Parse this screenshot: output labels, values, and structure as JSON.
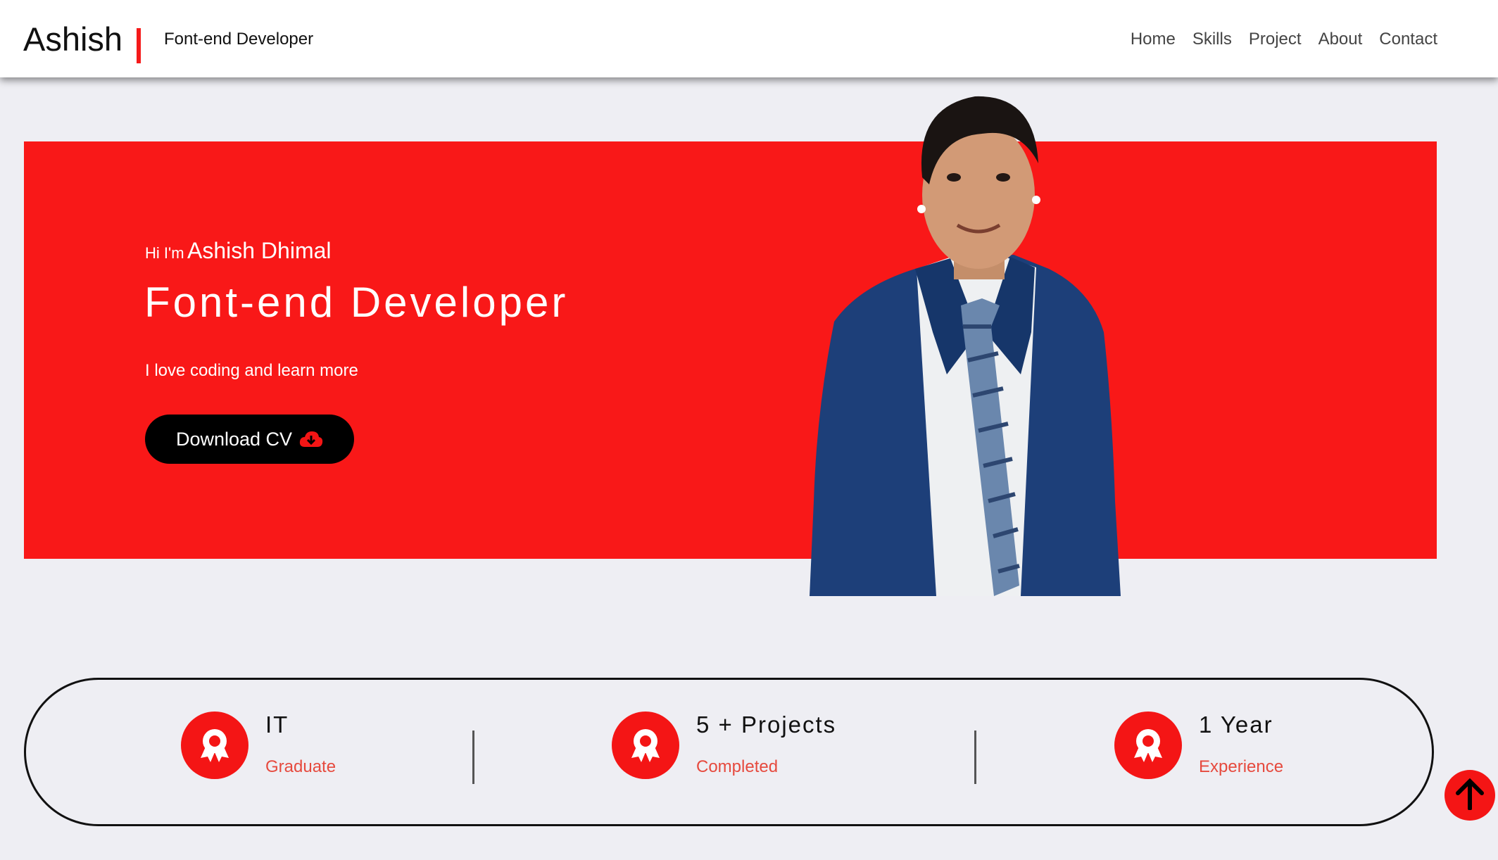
{
  "nav": {
    "brand": "Ashish",
    "subtitle": "Font-end Developer",
    "links": [
      "Home",
      "Skills",
      "Project",
      "About",
      "Contact"
    ]
  },
  "hero": {
    "greeting": "Hi I'm",
    "name": "Ashish Dhimal",
    "title": "Font-end Developer",
    "tagline": "I love coding and learn more",
    "cv_button": "Download CV",
    "cv_icon": "cloud-download-icon"
  },
  "stats": [
    {
      "value": "IT",
      "label": "Graduate",
      "icon": "award-icon"
    },
    {
      "value": "5 + Projects",
      "label": "Completed",
      "icon": "award-icon"
    },
    {
      "value": "1 Year",
      "label": "Experience",
      "icon": "award-icon"
    }
  ],
  "scroll_top_icon": "arrow-up-icon",
  "colors": {
    "accent": "#f91818",
    "page_bg": "#eeeef3",
    "stat_label": "#e64a3e",
    "button": "#000000"
  }
}
